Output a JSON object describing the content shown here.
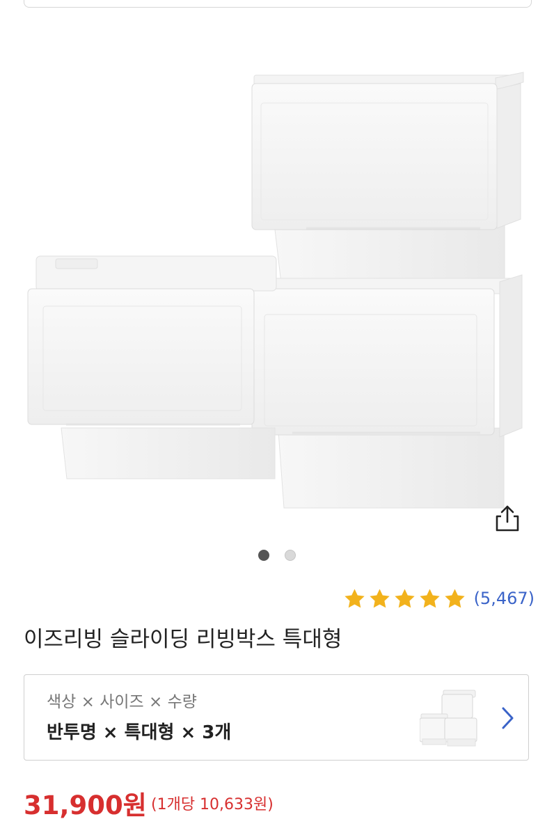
{
  "product": {
    "image_alt": "white sliding storage boxes",
    "title": "이즈리빙 슬라이딩 리빙박스 특대형"
  },
  "carousel": {
    "total": 2,
    "active_index": 0
  },
  "rating": {
    "stars": 5,
    "review_count": "(5,467)"
  },
  "options": {
    "label": "색상 × 사이즈 × 수량",
    "value": "반투명 × 특대형 × 3개"
  },
  "pricing": {
    "price": "31,900원",
    "unit_price": "(1개당 10,633원)"
  },
  "colors": {
    "accent_blue": "#3a63c8",
    "price_red": "#d72f2f",
    "star_gold": "#f2b21c"
  },
  "icons": {
    "share": "share-icon",
    "chevron": "chevron-right-icon",
    "star": "star-icon"
  }
}
